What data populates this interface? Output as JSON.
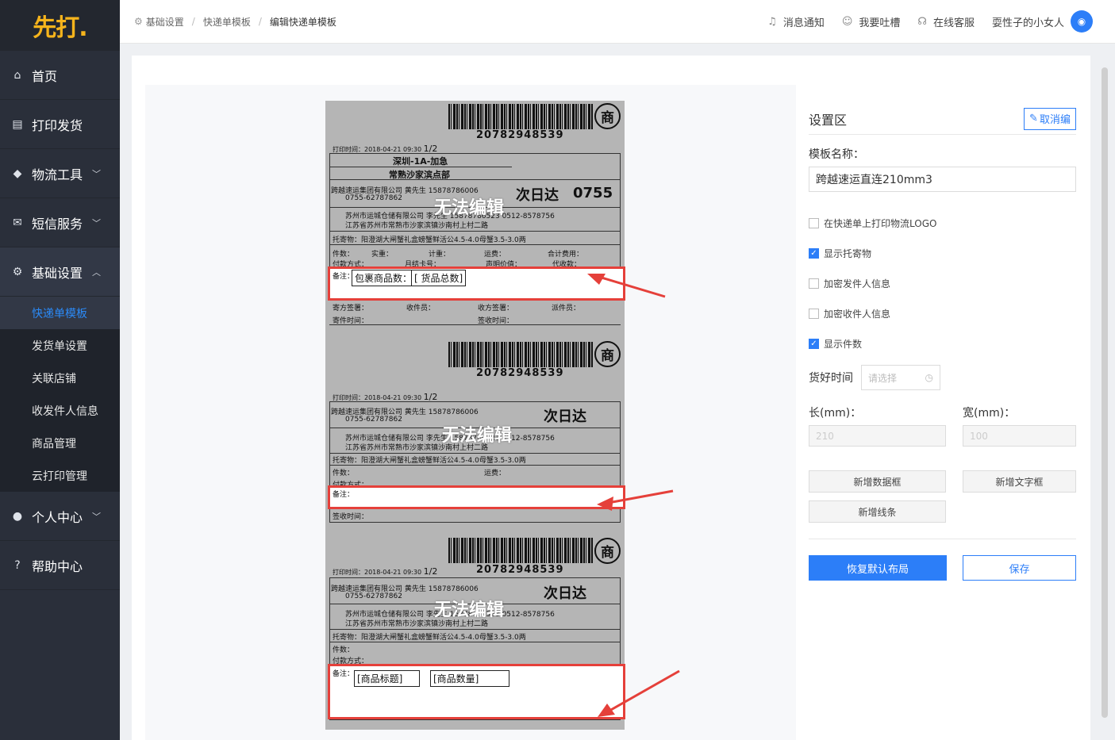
{
  "sidebar": {
    "logo": "先打.",
    "items": [
      {
        "label": "首页",
        "icon": "home-icon"
      },
      {
        "label": "打印发货",
        "icon": "printer-icon"
      },
      {
        "label": "物流工具",
        "icon": "cube-icon"
      },
      {
        "label": "短信服务",
        "icon": "mail-icon"
      },
      {
        "label": "基础设置",
        "icon": "gear-icon"
      },
      {
        "label": "个人中心",
        "icon": "user-icon"
      },
      {
        "label": "帮助中心",
        "icon": "help-icon"
      }
    ],
    "sub": [
      "快递单模板",
      "发货单设置",
      "关联店铺",
      "收发件人信息",
      "商品管理",
      "云打印管理"
    ]
  },
  "breadcrumb": [
    "基础设置",
    "快递单模板",
    "编辑快递单模板"
  ],
  "topbar": {
    "notify": "消息通知",
    "complain": "我要吐槽",
    "service": "在线客服",
    "user": "耍性子的小女人"
  },
  "label": {
    "barcode": "20782948539",
    "badge": "商",
    "print_time": "打印时间：2018-04-21 09:30",
    "page": "1/2",
    "route1": "深圳-1A-加急",
    "route2": "常熟沙家滨点部",
    "next_day": "次日达",
    "code": "0755",
    "sender": "跨越速运集团有限公司  黄先生 15878786006",
    "sender_phone": "0755-62787862",
    "recv": "苏州市运城仓储有限公司  李先生 15878786523  0512-8578756",
    "recv_addr": "江苏省苏州市常熟市沙家滨镇沙南村上村二路",
    "goods": "托寄物：阳澄湖大闸蟹礼盒螃蟹鲜活公4.5-4.0母蟹3.5-3.0两",
    "row1": [
      "件数：",
      "实重：",
      "计重：",
      "运费：",
      "合计费用："
    ],
    "row2": [
      "付款方式：",
      "月结卡号：",
      "声明价值：",
      "代收款："
    ],
    "note": "备注：",
    "wm": "无法编辑",
    "sign": [
      "寄方签署：",
      "收件员：",
      "收方签署：",
      "派件员："
    ],
    "time": "寄件时间：",
    "time2": "签收时间：",
    "ymd": [
      "年",
      "月",
      "日",
      "时",
      "分"
    ],
    "f1": "包裹商品数：",
    "f2": "[ 货品总数]",
    "f3": "[商品标题]",
    "f4": "[商品数量]",
    "sender_short": "跨越速运集团有限公司  黄先生 15878786006",
    "sh": "寄方",
    "rh": "收方"
  },
  "settings": {
    "title": "设置区",
    "cancel": "取消编",
    "name_label": "模板名称：",
    "name_value": "跨越速运直连210mm3",
    "checks": [
      {
        "label": "在快递单上打印物流LOGO",
        "on": false
      },
      {
        "label": "显示托寄物",
        "on": true
      },
      {
        "label": "加密发件人信息",
        "on": false
      },
      {
        "label": "加密收件人信息",
        "on": false
      },
      {
        "label": "显示件数",
        "on": true
      }
    ],
    "time_label": "货好时间",
    "time_ph": "请选择",
    "len_label": "长(mm)：",
    "len_val": "210",
    "wid_label": "宽(mm)：",
    "wid_val": "100",
    "btn_data": "新增数据框",
    "btn_text": "新增文字框",
    "btn_line": "新增线条",
    "btn_reset": "恢复默认布局",
    "btn_save": "保存"
  }
}
